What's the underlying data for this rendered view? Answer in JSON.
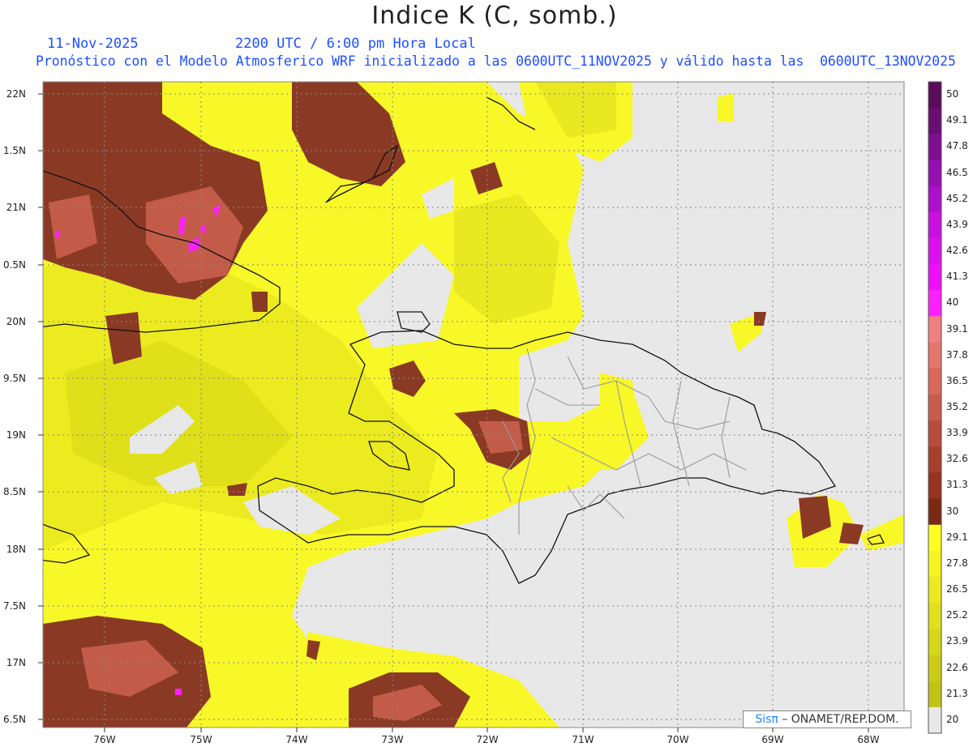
{
  "header": {
    "title": "Indice K (C, somb.)",
    "date": "11-Nov-2025",
    "time": "2200 UTC / 6:00 pm Hora Local",
    "model_line": "Pronóstico con el Modelo Atmosferico WRF inicializado a las 0600UTC_11NOV2025 y válido hasta las  0600UTC_13NOV2025"
  },
  "credit": {
    "brand": "Sis",
    "pi": "π",
    "text": "– ONAMET/REP.DOM."
  },
  "axes": {
    "lat_labels": [
      "22N",
      "1.5N",
      "21N",
      "0.5N",
      "20N",
      "9.5N",
      "19N",
      "8.5N",
      "18N",
      "7.5N",
      "17N",
      "6.5N"
    ],
    "lon_labels": [
      "76W",
      "75W",
      "74W",
      "73W",
      "72W",
      "71W",
      "70W",
      "69W",
      "68W"
    ]
  },
  "colorbar": {
    "labels": [
      "50",
      "49.1",
      "47.8",
      "46.5",
      "45.2",
      "43.9",
      "42.6",
      "41.3",
      "40",
      "39.1",
      "37.8",
      "36.5",
      "35.2",
      "33.9",
      "32.6",
      "31.3",
      "30",
      "29.1",
      "27.8",
      "26.5",
      "25.2",
      "23.9",
      "22.6",
      "21.3",
      "20"
    ],
    "colors": [
      "#5a0c5a",
      "#6a0e72",
      "#7d108e",
      "#9410b0",
      "#ac10cc",
      "#c810e0",
      "#dc10ee",
      "#ee10fa",
      "#ff20ff",
      "#f08080",
      "#e4766c",
      "#d8685c",
      "#c85c4c",
      "#b84c3c",
      "#a8402e",
      "#943420",
      "#7a2a14",
      "#ffff22",
      "#f4f422",
      "#eaea1e",
      "#e0e01c",
      "#d6d61a",
      "#cccc18",
      "#c2c216",
      "#e8e8e8"
    ]
  },
  "legend_colors": {
    "land_no_data": "#e8e8e8",
    "low": "#ffff22",
    "mid": "#d4d41a",
    "high": "#8a3a24",
    "extreme": "#ff20ff"
  }
}
